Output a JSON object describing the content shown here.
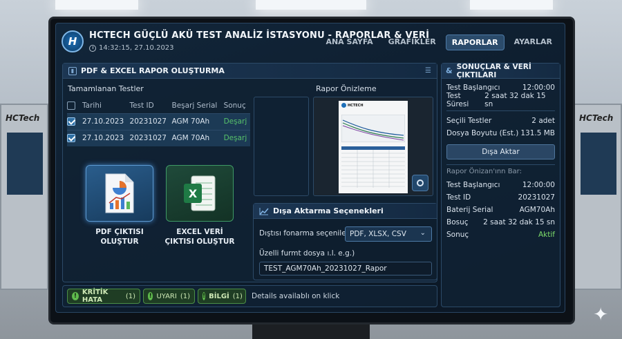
{
  "app": {
    "title": "HCTECH GÜÇLÜ AKÜ TEST ANALİZ İSTASYONU - RAPORLAR & VERİ",
    "datetime": "14:32:15, 27.10.2023",
    "logo_text": "H"
  },
  "nav": {
    "tabs": [
      "ANA SAYFA",
      "GRAFİKLER",
      "RAPORLAR",
      "AYARLAR"
    ],
    "active": "RAPORLAR"
  },
  "report_panel": {
    "title": "PDF & EXCEL RAPOR OLUŞTURMA",
    "completed_tests_label": "Tamamlanan Testler",
    "columns": [
      "Tarihi",
      "Test ID",
      "Beşarj Serial",
      "Sonuç"
    ],
    "rows": [
      {
        "date": "27.10.2023",
        "test_id": "20231027",
        "serial": "AGM 70Ah",
        "result": "Deşarj",
        "checked": true
      },
      {
        "date": "27.10.2023",
        "test_id": "20231027",
        "serial": "AGM 70Ah",
        "result": "Deşarj",
        "checked": true
      }
    ],
    "preview_label": "Rapor Önizleme",
    "preview_doc_brand": "HCTECH",
    "pdf_button_label_1": "PDF ÇIKTISI",
    "pdf_button_label_2": "OLUŞTUR",
    "excel_button_label_1": "EXCEL VERİ",
    "excel_button_label_2": "ÇIKTISI OLUŞTUR",
    "excel_icon_letter": "X"
  },
  "export_panel": {
    "title": "Dışa Aktarma Seçenekleri",
    "format_label": "Dıştısı fonarma seçenileri:",
    "format_value": "PDF, XLSX, CSV",
    "filename_label": "Üzelli furmt dosya ı.l. e.g.)",
    "filename_value": "TEST_AGM70Ah_20231027_Rapor"
  },
  "results_panel": {
    "title": "SONUÇLAR & VERİ ÇIKTILARI",
    "items_top": [
      {
        "k": "Test Başlangıcı",
        "v": "12:00:00"
      },
      {
        "k": "Test Süresi",
        "v": "2 saat 32 dak 15 sn"
      }
    ],
    "items_mid": [
      {
        "k": "Seçili Testler",
        "v": "2 adet"
      },
      {
        "k": "Dosya Boyutu (Est.)",
        "v": "131.5 MB"
      }
    ],
    "export_button": "Dışa Aktar",
    "preview_bar_label": "Rapor Önizan'ınn Bar:",
    "items_bottom": [
      {
        "k": "Test Başlangıcı",
        "v": "12:00:00"
      },
      {
        "k": "Test ID",
        "v": "20231027"
      },
      {
        "k": "Baterij Serial",
        "v": "AGM70Ah"
      },
      {
        "k": "Bosuç",
        "v": "2 saat 32 dak 15 sn"
      },
      {
        "k": "Sonuç",
        "v": "Aktif"
      }
    ]
  },
  "status_bar": {
    "alerts": [
      {
        "bold": "KRİTİK HATA",
        "count": "(1)"
      },
      {
        "bold": "UYARI",
        "count": "(1)"
      },
      {
        "bold": "BİLGİ",
        "count": "(1)"
      }
    ],
    "alert_icon": "!",
    "details_text": "Details availabIı on klick"
  },
  "background": {
    "machine_label": "HCTech"
  },
  "colors": {
    "accent": "#2b4b6b",
    "success": "#5fbb4d",
    "active_text": "#7ddc6a",
    "result_text": "#57c26a"
  }
}
